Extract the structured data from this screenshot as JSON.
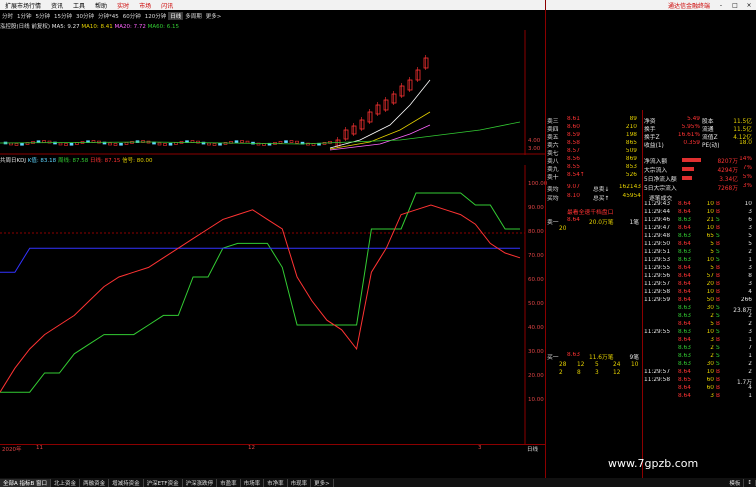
{
  "menu": {
    "items": [
      "扩展市场行情",
      "资讯",
      "工具",
      "帮助"
    ],
    "red_items": [
      "实时",
      "市场",
      "闪讯"
    ],
    "right_link": "通达信金融终端",
    "window_controls": [
      "-",
      "□",
      "×"
    ]
  },
  "periods": [
    "分时",
    "1分钟",
    "5分钟",
    "15分钟",
    "30分钟",
    "分钟*45",
    "60分钟",
    "120分钟",
    "日线",
    "多周期",
    "更多>"
  ],
  "active_period": "日线",
  "kline_legend": {
    "title": "泓控股(日线 前复权)",
    "ma5": "MA5: 9.27",
    "ma10": "MA10: 8.41",
    "ma20": "MA20: 7.72",
    "ma60": "MA60: 6.15"
  },
  "kline_axis": [
    "4.00",
    "3.00"
  ],
  "kdj_legend": {
    "title": "共周日KDJ",
    "k": "K值: 83.18",
    "d": "周线: 87.58",
    "j": "日线: 87.15",
    "e": "信号: 80.00"
  },
  "kdj_axis": [
    "100.00",
    "90.00",
    "80.00",
    "70.00",
    "60.00",
    "50.00",
    "40.00",
    "30.00",
    "20.00",
    "10.00"
  ],
  "time_axis": [
    "2020年",
    "11",
    "12",
    "3"
  ],
  "colors": {
    "up": "#ff3333",
    "down": "#33cc33",
    "ma5": "#ffffff",
    "ma10": "#e6d200",
    "ma20": "#ff66ff",
    "ma60": "#33cc33"
  },
  "order_book": {
    "sells": [
      {
        "label": "卖三",
        "price": "8.61",
        "vol": "89"
      },
      {
        "label": "卖四",
        "price": "8.60",
        "vol": "210"
      },
      {
        "label": "卖五",
        "price": "8.59",
        "vol": "198"
      },
      {
        "label": "卖六",
        "price": "8.58",
        "vol": "865"
      },
      {
        "label": "卖七",
        "price": "8.57",
        "vol": "509"
      },
      {
        "label": "卖八",
        "price": "8.56",
        "vol": "869"
      },
      {
        "label": "卖九",
        "price": "8.55",
        "vol": "853"
      },
      {
        "label": "卖十",
        "price": "8.54↑",
        "vol": "526"
      }
    ],
    "stats": [
      {
        "k": "净资",
        "v": "5.49",
        "k2": "股本",
        "v2": "11.5亿"
      },
      {
        "k": "换手",
        "v": "5.95%",
        "k2": "流通",
        "v2": "11.5亿"
      },
      {
        "k": "换手Z",
        "v": "16.61%",
        "k2": "流值Z",
        "v2": "4.12亿"
      },
      {
        "k": "收益(1)",
        "v": "0.359",
        "k2": "PE(动)",
        "v2": "18.0"
      }
    ],
    "avg_row": {
      "label": "卖均",
      "price": "9.07",
      "k": "总卖↓",
      "v": "162143"
    },
    "buy_avg_row": {
      "label": "买均",
      "price": "8.10",
      "k": "总买↑",
      "v": "45954"
    }
  },
  "fund_flow": [
    {
      "label": "净流入额",
      "bar": 0.58,
      "value": "8207万",
      "pct": "14%"
    },
    {
      "label": "大宗流入",
      "bar": 0.36,
      "value": "4294万",
      "pct": "7%"
    },
    {
      "label": "5日净流入额",
      "bar": 0.32,
      "value": "3.34亿",
      "pct": "5%"
    },
    {
      "label": "5日大宗流入",
      "bar": 0.0,
      "value": "7268万",
      "pct": "3%"
    }
  ],
  "fund_header": "逐笔成交",
  "queue": {
    "header": "最看全速千档盘口",
    "first_label": "卖一",
    "first_price": "8.64",
    "first_vol": "20.0万笔",
    "first_cnt": "1笔",
    "extra_value": "20",
    "buy_label": "买一",
    "buy_price": "8.63",
    "buy_vol": "11.6万笔",
    "buy_cnt": "9笔",
    "grid": [
      [
        "28",
        "12",
        "5",
        "24",
        "10"
      ],
      [
        "2",
        "8",
        "3",
        "12",
        ""
      ]
    ]
  },
  "ticks": [
    {
      "t": "11:29:43",
      "p": "8.64",
      "v": "10",
      "f": "B",
      "n": "10"
    },
    {
      "t": "11:29:44",
      "p": "8.64",
      "v": "10",
      "f": "B",
      "n": "3"
    },
    {
      "t": "11:29:46",
      "p": "8.63",
      "v": "21",
      "f": "S",
      "n": "6"
    },
    {
      "t": "11:29:47",
      "p": "8.64",
      "v": "10",
      "f": "B",
      "n": "3"
    },
    {
      "t": "11:29:48",
      "p": "8.63",
      "v": "65",
      "f": "S",
      "n": "5"
    },
    {
      "t": "11:29:50",
      "p": "8.64",
      "v": "5",
      "f": "B",
      "n": "5"
    },
    {
      "t": "11:29:51",
      "p": "8.63",
      "v": "5",
      "f": "S",
      "n": "2"
    },
    {
      "t": "11:29:53",
      "p": "8.63",
      "v": "10",
      "f": "S",
      "n": "1"
    },
    {
      "t": "11:29:55",
      "p": "8.64",
      "v": "5",
      "f": "B",
      "n": "3"
    },
    {
      "t": "11:29:56",
      "p": "8.64",
      "v": "57",
      "f": "B",
      "n": "8"
    },
    {
      "t": "11:29:57",
      "p": "8.64",
      "v": "20",
      "f": "B",
      "n": "3"
    },
    {
      "t": "11:29:58",
      "p": "8.64",
      "v": "10",
      "f": "B",
      "n": "4"
    },
    {
      "t": "11:29:59",
      "p": "8.64",
      "v": "50",
      "f": "B",
      "n": "266"
    },
    {
      "t": "",
      "p": "8.63",
      "v": "30",
      "f": "S",
      "n": "23.8万"
    },
    {
      "t": "",
      "p": "8.63",
      "v": "2",
      "f": "S",
      "n": "2"
    },
    {
      "t": "",
      "p": "8.64",
      "v": "5",
      "f": "B",
      "n": "2"
    },
    {
      "t": "11:29:55",
      "p": "8.63",
      "v": "10",
      "f": "S",
      "n": "3"
    },
    {
      "t": "",
      "p": "8.64",
      "v": "3",
      "f": "B",
      "n": "1"
    },
    {
      "t": "",
      "p": "8.63",
      "v": "2",
      "f": "S",
      "n": "7"
    },
    {
      "t": "",
      "p": "8.63",
      "v": "2",
      "f": "S",
      "n": "1"
    },
    {
      "t": "",
      "p": "8.63",
      "v": "30",
      "f": "S",
      "n": "2"
    },
    {
      "t": "11:29:57",
      "p": "8.64",
      "v": "10",
      "f": "B",
      "n": "2"
    },
    {
      "t": "11:29:58",
      "p": "8.65",
      "v": "60",
      "f": "B",
      "n": "1.7万"
    },
    {
      "t": "",
      "p": "8.64",
      "v": "60",
      "f": "B",
      "n": "4"
    },
    {
      "t": "",
      "p": "8.64",
      "v": "3",
      "f": "B",
      "n": "1"
    }
  ],
  "bottom_tabs": [
    "全部A 指标B 窗口",
    "北上资金",
    "两融资金",
    "增减持资金",
    "沪深ETF资金",
    "沪深涨跌停",
    "市盈率",
    "市场率",
    "市净率",
    "市现率",
    "更多>"
  ],
  "bottom_right": [
    "模板",
    "↕"
  ],
  "right_axis_label": "日线",
  "watermark": "www.7gpzb.com",
  "kdj_data": {
    "j": [
      12,
      22,
      30,
      36,
      40,
      44,
      50,
      56,
      60,
      62,
      64,
      68,
      72,
      76,
      80,
      84,
      86,
      88,
      84,
      80,
      60,
      50,
      42,
      38,
      30,
      62,
      72,
      86,
      88,
      90,
      88,
      86,
      82,
      74,
      70,
      68
    ],
    "k": [
      12,
      12,
      12,
      20,
      20,
      28,
      32,
      36,
      36,
      36,
      40,
      44,
      44,
      60,
      60,
      72,
      74,
      74,
      74,
      64,
      40,
      40,
      40,
      40,
      40,
      80,
      80,
      80,
      95,
      95,
      95,
      95,
      90,
      90,
      80,
      80
    ],
    "d": [
      62,
      62,
      72,
      72,
      72,
      72,
      72,
      72,
      72,
      72,
      72,
      72,
      72,
      72,
      72,
      72,
      72,
      72,
      72,
      72,
      72,
      72,
      72,
      72,
      72,
      72,
      72,
      72,
      72,
      72,
      72,
      72,
      72,
      72,
      72,
      72
    ]
  }
}
